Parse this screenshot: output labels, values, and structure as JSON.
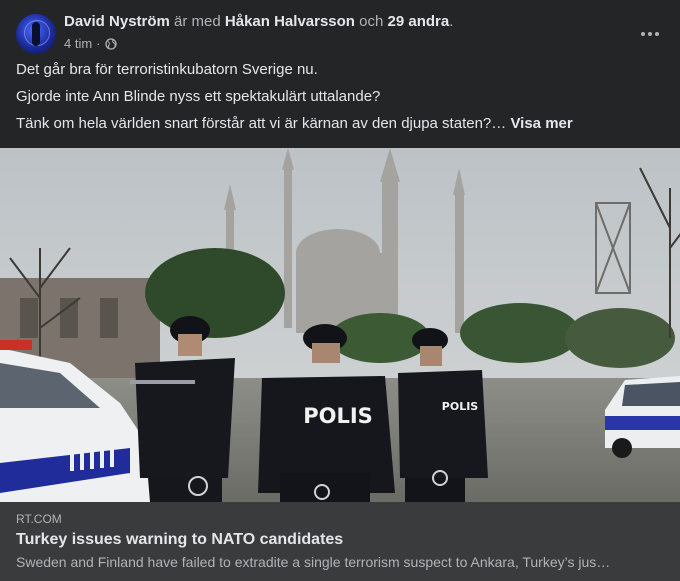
{
  "post": {
    "author": "David Nyström",
    "with_text": "är med",
    "tagged": "Håkan Halvarsson",
    "and_text": "och",
    "others": "29 andra",
    "period": ".",
    "time": "4 tim",
    "separator": "·",
    "audience_icon": "globe-icon",
    "more_icon": "more-options-icon"
  },
  "body": {
    "line1": "Det går bra för terroristinkubatorn Sverige nu.",
    "line2": "Gjorde inte Ann Blinde nyss ett spektakulärt uttalande?",
    "line3": "Tänk om hela världen snart förstår att vi är kärnan av den djupa staten?…",
    "see_more": "Visa mer"
  },
  "photo": {
    "vest_label_center": "POLIS",
    "vest_label_right": "POLIS"
  },
  "link": {
    "domain": "RT.COM",
    "title": "Turkey issues warning to NATO candidates",
    "description": "Sweden and Finland have failed to extradite a single terrorism suspect to Ankara, Turkey’s jus…"
  }
}
